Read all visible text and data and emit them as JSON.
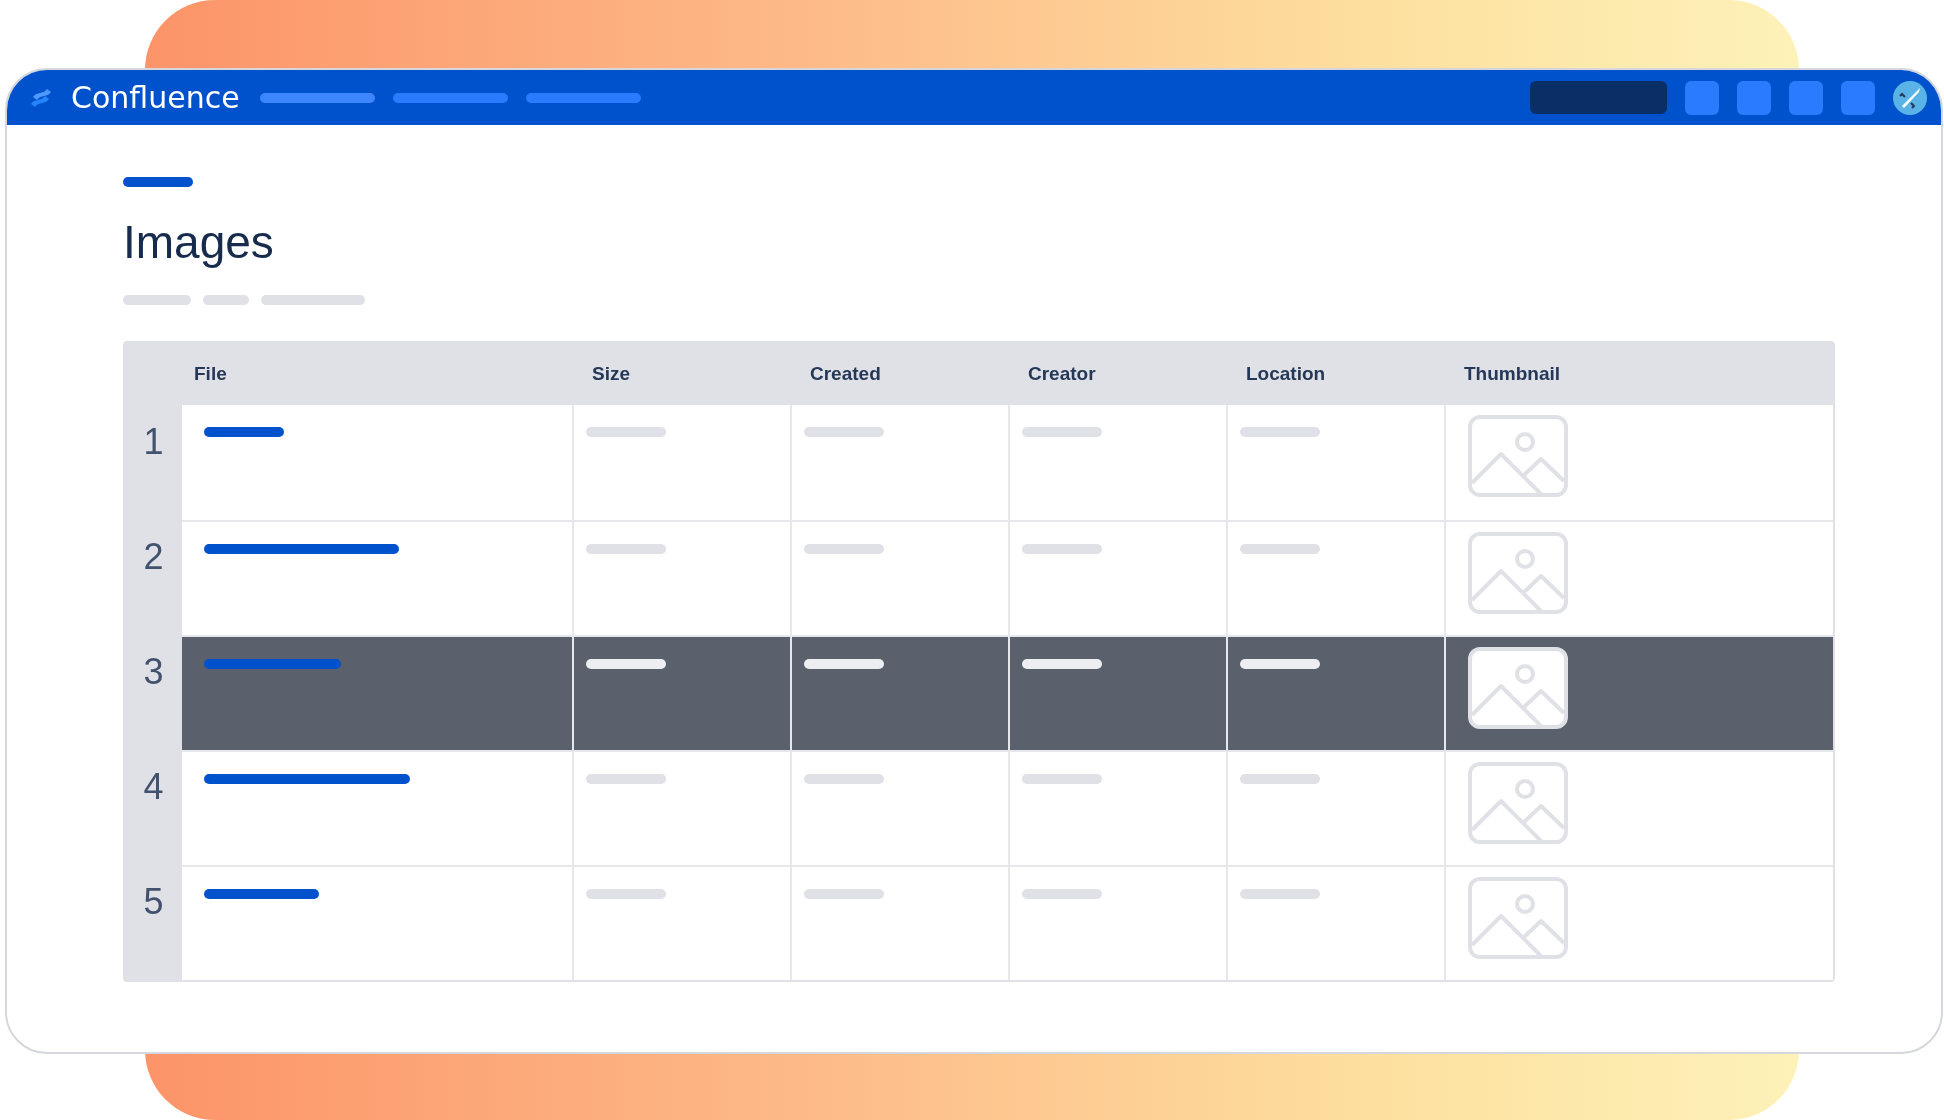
{
  "app": {
    "name": "Confluence"
  },
  "page": {
    "title": "Images"
  },
  "table": {
    "columns": [
      "File",
      "Size",
      "Created",
      "Creator",
      "Location",
      "Thumbnail"
    ],
    "rows": [
      {
        "number": "1",
        "selected": false
      },
      {
        "number": "2",
        "selected": false
      },
      {
        "number": "3",
        "selected": true
      },
      {
        "number": "4",
        "selected": false
      },
      {
        "number": "5",
        "selected": false
      }
    ]
  }
}
